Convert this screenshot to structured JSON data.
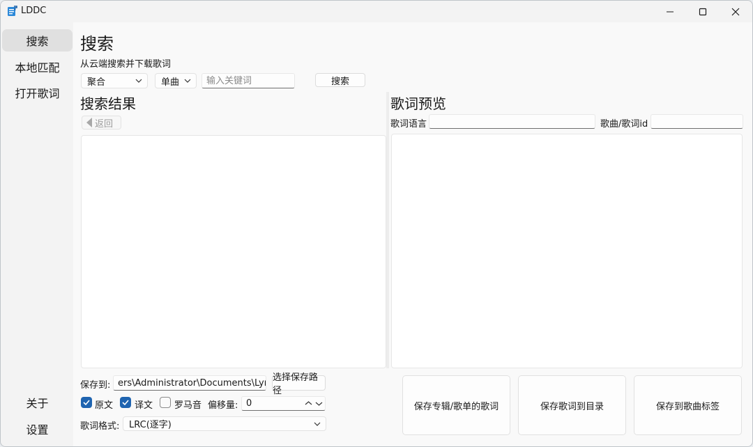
{
  "window": {
    "title": "LDDC"
  },
  "sidebar": {
    "items": [
      {
        "label": "搜索"
      },
      {
        "label": "本地匹配"
      },
      {
        "label": "打开歌词"
      }
    ],
    "bottom_items": [
      {
        "label": "关于"
      },
      {
        "label": "设置"
      }
    ]
  },
  "search": {
    "title": "搜索",
    "subtitle": "从云端搜索并下载歌词",
    "source_select": "聚合",
    "type_select": "单曲",
    "keyword_placeholder": "输入关键词",
    "search_button": "搜索"
  },
  "results": {
    "title": "搜索结果",
    "back_button": "返回"
  },
  "preview": {
    "title": "歌词预览",
    "language_label": "歌词语言",
    "language_value": "",
    "id_label": "歌曲/歌词id",
    "id_value": ""
  },
  "save": {
    "path_label": "保存到:",
    "path_value": "ers\\Administrator\\Documents\\Lyrics",
    "choose_path_button": "选择保存路径",
    "options": [
      {
        "label": "原文",
        "checked": true
      },
      {
        "label": "译文",
        "checked": true
      },
      {
        "label": "罗马音",
        "checked": false
      }
    ],
    "offset_label": "偏移量:",
    "offset_value": "0",
    "format_label": "歌词格式:",
    "format_value": "LRC(逐字)",
    "actions": [
      {
        "label": "保存专辑/歌单的歌词"
      },
      {
        "label": "保存歌词到目录"
      },
      {
        "label": "保存到歌曲标签"
      }
    ]
  },
  "colors": {
    "accent": "#1f64b0",
    "window_bg": "#f3f3f3",
    "content_bg": "#f9f9f9",
    "active_nav": "#e0e0e0"
  }
}
